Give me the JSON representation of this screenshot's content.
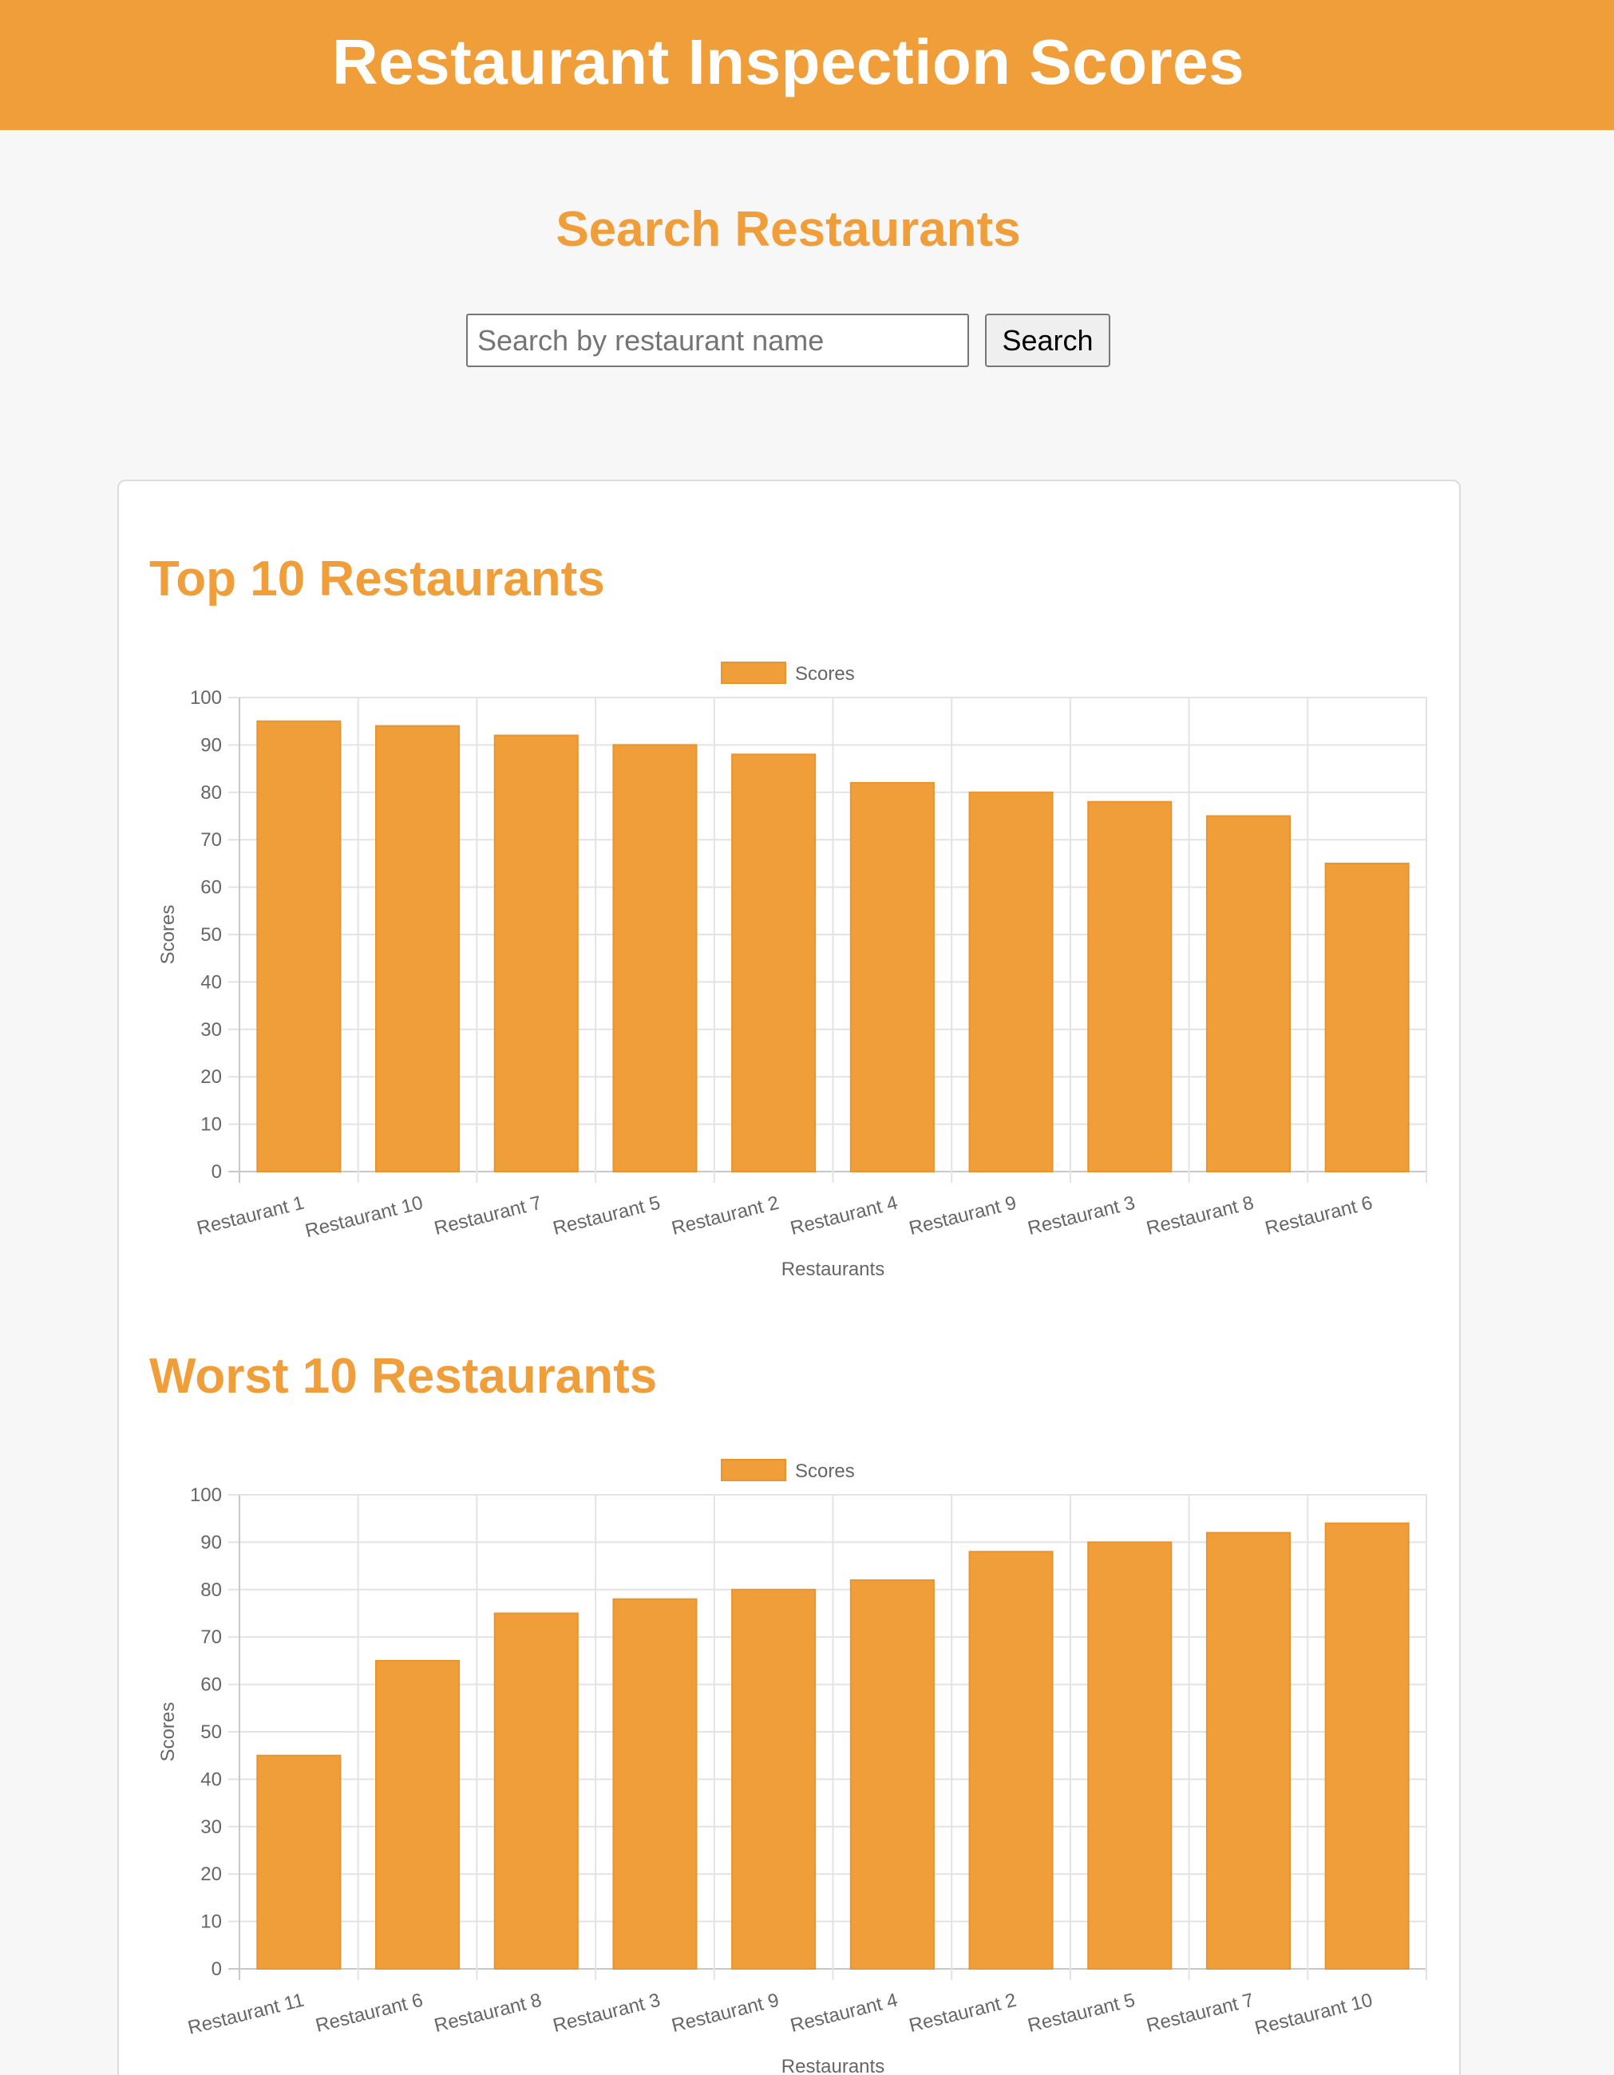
{
  "header": {
    "title": "Restaurant Inspection Scores"
  },
  "search": {
    "heading": "Search Restaurants",
    "placeholder": "Search by restaurant name",
    "value": "",
    "button_label": "Search"
  },
  "sections": [
    {
      "title": "Top 10 Restaurants"
    },
    {
      "title": "Worst 10 Restaurants"
    }
  ],
  "colors": {
    "accent": "#f09e3a",
    "bar": "#f09e3a",
    "bar_border": "#e89530"
  },
  "chart_data": [
    {
      "type": "bar",
      "legend": "Scores",
      "legend_position": "top",
      "xlabel": "Restaurants",
      "ylabel": "Scores",
      "ylim": [
        0,
        100
      ],
      "yticks": [
        0,
        10,
        20,
        30,
        40,
        50,
        60,
        70,
        80,
        90,
        100
      ],
      "grid": true,
      "categories": [
        "Restaurant 1",
        "Restaurant 10",
        "Restaurant 7",
        "Restaurant 5",
        "Restaurant 2",
        "Restaurant 4",
        "Restaurant 9",
        "Restaurant 3",
        "Restaurant 8",
        "Restaurant 6"
      ],
      "values": [
        95,
        94,
        92,
        90,
        88,
        82,
        80,
        78,
        75,
        65
      ]
    },
    {
      "type": "bar",
      "legend": "Scores",
      "legend_position": "top",
      "xlabel": "Restaurants",
      "ylabel": "Scores",
      "ylim": [
        0,
        100
      ],
      "yticks": [
        0,
        10,
        20,
        30,
        40,
        50,
        60,
        70,
        80,
        90,
        100
      ],
      "grid": true,
      "categories": [
        "Restaurant 11",
        "Restaurant 6",
        "Restaurant 8",
        "Restaurant 3",
        "Restaurant 9",
        "Restaurant 4",
        "Restaurant 2",
        "Restaurant 5",
        "Restaurant 7",
        "Restaurant 10"
      ],
      "values": [
        45,
        65,
        75,
        78,
        80,
        82,
        88,
        90,
        92,
        94
      ]
    }
  ]
}
